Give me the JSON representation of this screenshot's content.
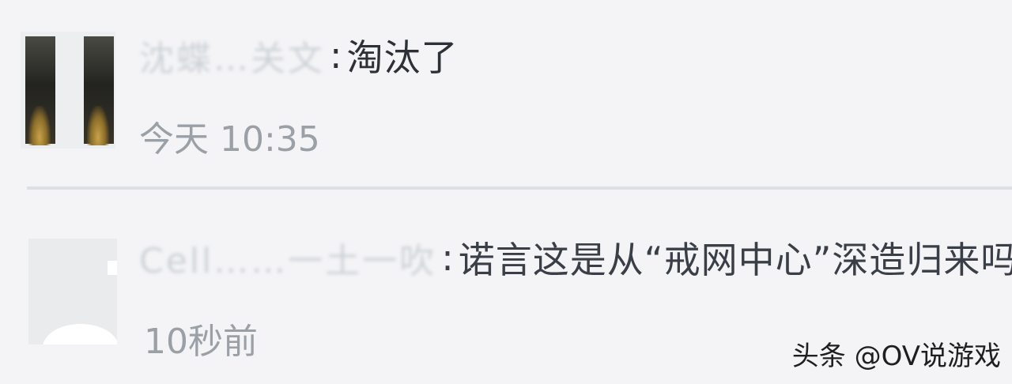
{
  "comments": [
    {
      "username": "沈蝶…关文",
      "text": "淘汰了",
      "time": "今天 10:35",
      "avatar_icon": "dark-two-panel-avatar"
    },
    {
      "username": "Cell……一土一吹",
      "text": "诺言这是从“戒网中心”深造归来吗?",
      "time": "10秒前",
      "avatar_icon": "default-gray-avatar"
    }
  ],
  "watermark": "头条 @OV说游戏"
}
